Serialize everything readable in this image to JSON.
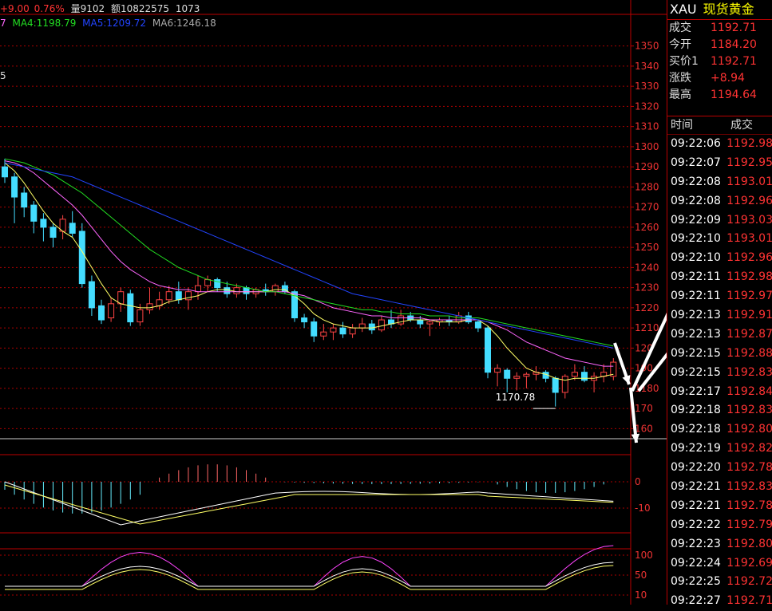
{
  "header": {
    "change": "+9.00",
    "change_pct": "0.76%",
    "volume_label": "量",
    "volume": "9102",
    "amount_label": "额",
    "amount": "10822575",
    "extra": "1073"
  },
  "ma_legend": [
    {
      "label": "7",
      "color": "#ff66ff"
    },
    {
      "label": "MA4:1198.79",
      "color": "#22dd22"
    },
    {
      "label": "MA5:1209.72",
      "color": "#2244ff"
    },
    {
      "label": "MA6:1246.18",
      "color": "#aaaaaa"
    }
  ],
  "left_fragment": "5",
  "sidebar": {
    "symbol": "XAU",
    "name": "现货黄金",
    "quotes": [
      {
        "k": "成交",
        "v": "1192.71"
      },
      {
        "k": "今开",
        "v": "1184.20"
      },
      {
        "k": "买价1",
        "v": "1192.71"
      },
      {
        "k": "涨跌",
        "v": "+8.94"
      },
      {
        "k": "最高",
        "v": "1194.64"
      }
    ],
    "tick_header": {
      "time": "时间",
      "price": "成交"
    },
    "ticks": [
      {
        "t": "09:22:06",
        "p": "1192.98"
      },
      {
        "t": "09:22:07",
        "p": "1192.95"
      },
      {
        "t": "09:22:08",
        "p": "1193.01"
      },
      {
        "t": "09:22:08",
        "p": "1192.96"
      },
      {
        "t": "09:22:09",
        "p": "1193.03"
      },
      {
        "t": "09:22:10",
        "p": "1193.01"
      },
      {
        "t": "09:22:10",
        "p": "1192.96"
      },
      {
        "t": "09:22:11",
        "p": "1192.98"
      },
      {
        "t": "09:22:11",
        "p": "1192.97"
      },
      {
        "t": "09:22:13",
        "p": "1192.91"
      },
      {
        "t": "09:22:13",
        "p": "1192.87"
      },
      {
        "t": "09:22:15",
        "p": "1192.88"
      },
      {
        "t": "09:22:15",
        "p": "1192.83"
      },
      {
        "t": "09:22:17",
        "p": "1192.84"
      },
      {
        "t": "09:22:18",
        "p": "1192.83"
      },
      {
        "t": "09:22:18",
        "p": "1192.80"
      },
      {
        "t": "09:22:19",
        "p": "1192.82"
      },
      {
        "t": "09:22:20",
        "p": "1192.78"
      },
      {
        "t": "09:22:21",
        "p": "1192.83"
      },
      {
        "t": "09:22:21",
        "p": "1192.78"
      },
      {
        "t": "09:22:22",
        "p": "1192.79"
      },
      {
        "t": "09:22:23",
        "p": "1192.80"
      },
      {
        "t": "09:22:24",
        "p": "1192.69"
      },
      {
        "t": "09:22:25",
        "p": "1192.72"
      },
      {
        "t": "09:22:27",
        "p": "1192.71"
      }
    ]
  },
  "chart_data": {
    "type": "candlestick",
    "price_axis": {
      "ylim": [
        1155,
        1357
      ],
      "ticks": [
        1350,
        1340,
        1330,
        1320,
        1310,
        1300,
        1290,
        1280,
        1270,
        1260,
        1250,
        1240,
        1230,
        1220,
        1210,
        1200,
        1190,
        1180,
        1170,
        1160
      ],
      "tick_labels": [
        "1350",
        "1340",
        "1330",
        "1320",
        "1310",
        "1300",
        "1290",
        "1280",
        "1270",
        "1260",
        "1250",
        "1240",
        "1230",
        "1220",
        "1210",
        "120",
        "190",
        "1180",
        "170",
        "160"
      ]
    },
    "min_label": "1170.78",
    "min_value": 1170.78,
    "candles": [
      {
        "o": 1290,
        "c": 1285,
        "h": 1294,
        "l": 1282
      },
      {
        "o": 1285,
        "c": 1275,
        "h": 1287,
        "l": 1262
      },
      {
        "o": 1277,
        "c": 1270,
        "h": 1280,
        "l": 1265
      },
      {
        "o": 1271,
        "c": 1263,
        "h": 1273,
        "l": 1257
      },
      {
        "o": 1264,
        "c": 1260,
        "h": 1267,
        "l": 1253
      },
      {
        "o": 1260,
        "c": 1255,
        "h": 1262,
        "l": 1250
      },
      {
        "o": 1258,
        "c": 1264,
        "h": 1266,
        "l": 1254
      },
      {
        "o": 1262,
        "c": 1257,
        "h": 1268,
        "l": 1255
      },
      {
        "o": 1258,
        "c": 1232,
        "h": 1262,
        "l": 1230
      },
      {
        "o": 1233,
        "c": 1220,
        "h": 1236,
        "l": 1216
      },
      {
        "o": 1221,
        "c": 1214,
        "h": 1224,
        "l": 1212
      },
      {
        "o": 1215,
        "c": 1222,
        "h": 1225,
        "l": 1213
      },
      {
        "o": 1222,
        "c": 1228,
        "h": 1230,
        "l": 1218
      },
      {
        "o": 1227,
        "c": 1213,
        "h": 1229,
        "l": 1211
      },
      {
        "o": 1213,
        "c": 1219,
        "h": 1222,
        "l": 1211
      },
      {
        "o": 1219,
        "c": 1222,
        "h": 1230,
        "l": 1217
      },
      {
        "o": 1221,
        "c": 1224,
        "h": 1228,
        "l": 1219
      },
      {
        "o": 1224,
        "c": 1228,
        "h": 1231,
        "l": 1222
      },
      {
        "o": 1228,
        "c": 1224,
        "h": 1233,
        "l": 1222
      },
      {
        "o": 1224,
        "c": 1228,
        "h": 1230,
        "l": 1219
      },
      {
        "o": 1228,
        "c": 1231,
        "h": 1236,
        "l": 1224
      },
      {
        "o": 1231,
        "c": 1234,
        "h": 1236,
        "l": 1228
      },
      {
        "o": 1234,
        "c": 1230,
        "h": 1235,
        "l": 1228
      },
      {
        "o": 1230,
        "c": 1227,
        "h": 1233,
        "l": 1225
      },
      {
        "o": 1227,
        "c": 1230,
        "h": 1232,
        "l": 1225
      },
      {
        "o": 1230,
        "c": 1227,
        "h": 1231,
        "l": 1224
      },
      {
        "o": 1227,
        "c": 1229,
        "h": 1230,
        "l": 1225
      },
      {
        "o": 1229,
        "c": 1228,
        "h": 1232,
        "l": 1226
      },
      {
        "o": 1228,
        "c": 1231,
        "h": 1232,
        "l": 1226
      },
      {
        "o": 1231,
        "c": 1228,
        "h": 1233,
        "l": 1227
      },
      {
        "o": 1228,
        "c": 1215,
        "h": 1229,
        "l": 1213
      },
      {
        "o": 1215,
        "c": 1213,
        "h": 1217,
        "l": 1210
      },
      {
        "o": 1213,
        "c": 1206,
        "h": 1215,
        "l": 1203
      },
      {
        "o": 1206,
        "c": 1208,
        "h": 1212,
        "l": 1204
      },
      {
        "o": 1208,
        "c": 1210,
        "h": 1212,
        "l": 1204
      },
      {
        "o": 1210,
        "c": 1207,
        "h": 1213,
        "l": 1205
      },
      {
        "o": 1207,
        "c": 1210,
        "h": 1212,
        "l": 1205
      },
      {
        "o": 1210,
        "c": 1212,
        "h": 1215,
        "l": 1208
      },
      {
        "o": 1212,
        "c": 1209,
        "h": 1214,
        "l": 1207
      },
      {
        "o": 1209,
        "c": 1214,
        "h": 1216,
        "l": 1208
      },
      {
        "o": 1214,
        "c": 1212,
        "h": 1219,
        "l": 1210
      },
      {
        "o": 1212,
        "c": 1216,
        "h": 1219,
        "l": 1211
      },
      {
        "o": 1216,
        "c": 1214,
        "h": 1218,
        "l": 1213
      },
      {
        "o": 1214,
        "c": 1212,
        "h": 1216,
        "l": 1210
      },
      {
        "o": 1212,
        "c": 1213,
        "h": 1214,
        "l": 1206
      },
      {
        "o": 1213,
        "c": 1214,
        "h": 1215,
        "l": 1211
      },
      {
        "o": 1214,
        "c": 1213,
        "h": 1216,
        "l": 1211
      },
      {
        "o": 1213,
        "c": 1216,
        "h": 1218,
        "l": 1212
      },
      {
        "o": 1216,
        "c": 1213,
        "h": 1218,
        "l": 1212
      },
      {
        "o": 1213,
        "c": 1210,
        "h": 1214,
        "l": 1208
      },
      {
        "o": 1210,
        "c": 1188,
        "h": 1211,
        "l": 1185
      },
      {
        "o": 1188,
        "c": 1190,
        "h": 1192,
        "l": 1181
      },
      {
        "o": 1189,
        "c": 1185,
        "h": 1190,
        "l": 1178
      },
      {
        "o": 1185,
        "c": 1186,
        "h": 1188,
        "l": 1179
      },
      {
        "o": 1186,
        "c": 1187,
        "h": 1188,
        "l": 1180
      },
      {
        "o": 1187,
        "c": 1188,
        "h": 1191,
        "l": 1184
      },
      {
        "o": 1188,
        "c": 1185,
        "h": 1189,
        "l": 1183
      },
      {
        "o": 1185,
        "c": 1178,
        "h": 1186,
        "l": 1171
      },
      {
        "o": 1178,
        "c": 1186,
        "h": 1187,
        "l": 1175
      },
      {
        "o": 1186,
        "c": 1188,
        "h": 1192,
        "l": 1184
      },
      {
        "o": 1188,
        "c": 1184,
        "h": 1191,
        "l": 1183
      },
      {
        "o": 1184,
        "c": 1186,
        "h": 1188,
        "l": 1178
      },
      {
        "o": 1186,
        "c": 1188,
        "h": 1192,
        "l": 1183
      },
      {
        "o": 1186,
        "c": 1193,
        "h": 1195,
        "l": 1184
      }
    ],
    "ma_lines": [
      {
        "color": "#ffff66",
        "values": [
          1292,
          1288,
          1282,
          1275,
          1268,
          1262,
          1258,
          1255,
          1248,
          1240,
          1232,
          1225,
          1222,
          1221,
          1220,
          1220,
          1221,
          1223,
          1224,
          1225,
          1226,
          1228,
          1229,
          1229,
          1228,
          1228,
          1228,
          1228,
          1229,
          1229,
          1226,
          1222,
          1217,
          1214,
          1212,
          1211,
          1210,
          1210,
          1210,
          1211,
          1212,
          1213,
          1214,
          1214,
          1214,
          1213,
          1213,
          1213,
          1214,
          1214,
          1211,
          1206,
          1200,
          1195,
          1190,
          1188,
          1187,
          1185,
          1184,
          1185,
          1185,
          1185,
          1186,
          1187
        ]
      },
      {
        "color": "#ff66ff",
        "values": [
          1293,
          1292,
          1290,
          1287,
          1283,
          1279,
          1275,
          1271,
          1266,
          1260,
          1254,
          1248,
          1243,
          1239,
          1236,
          1233,
          1231,
          1230,
          1229,
          1229,
          1228,
          1228,
          1228,
          1228,
          1228,
          1228,
          1228,
          1228,
          1228,
          1228,
          1227,
          1226,
          1224,
          1222,
          1220,
          1219,
          1218,
          1217,
          1216,
          1216,
          1215,
          1215,
          1215,
          1215,
          1214,
          1214,
          1214,
          1214,
          1214,
          1214,
          1213,
          1211,
          1209,
          1206,
          1203,
          1201,
          1199,
          1197,
          1195,
          1194,
          1193,
          1192,
          1191,
          1191
        ]
      },
      {
        "color": "#22dd22",
        "values": [
          1294,
          1293,
          1292,
          1290,
          1288,
          1286,
          1283,
          1280,
          1277,
          1273,
          1269,
          1265,
          1261,
          1257,
          1253,
          1249,
          1246,
          1243,
          1240,
          1238,
          1236,
          1234,
          1233,
          1232,
          1231,
          1230,
          1229,
          1228,
          1228,
          1227,
          1226,
          1225,
          1224,
          1223,
          1222,
          1221,
          1220,
          1219,
          1219,
          1218,
          1218,
          1217,
          1217,
          1217,
          1216,
          1216,
          1216,
          1215,
          1215,
          1215,
          1214,
          1213,
          1212,
          1211,
          1210,
          1209,
          1208,
          1207,
          1206,
          1205,
          1204,
          1203,
          1202,
          1201
        ]
      },
      {
        "color": "#2244ff",
        "values": [
          1292,
          1291,
          1290,
          1289,
          1288,
          1287,
          1286,
          1285,
          1283,
          1281,
          1279,
          1277,
          1275,
          1273,
          1271,
          1269,
          1267,
          1265,
          1263,
          1261,
          1259,
          1257,
          1255,
          1253,
          1251,
          1249,
          1247,
          1245,
          1243,
          1241,
          1239,
          1237,
          1235,
          1233,
          1231,
          1229,
          1227,
          1226,
          1225,
          1224,
          1223,
          1222,
          1221,
          1220,
          1219,
          1218,
          1217,
          1216,
          1215,
          1214,
          1213,
          1212,
          1211,
          1210,
          1209,
          1208,
          1207,
          1206,
          1205,
          1204,
          1203,
          1202,
          1201,
          1200
        ]
      }
    ]
  }
}
